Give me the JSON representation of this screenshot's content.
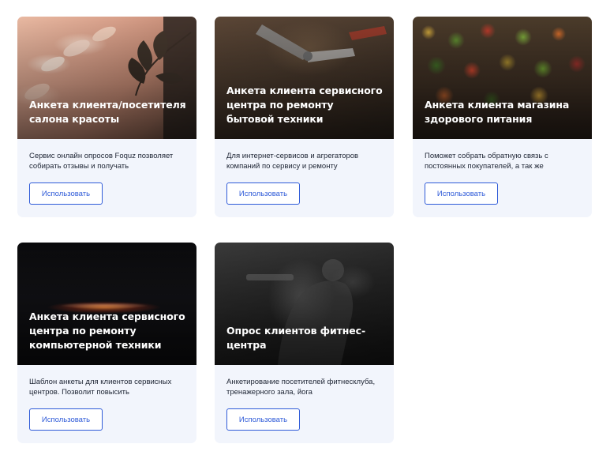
{
  "cards": [
    {
      "image": "beauty-salon-photo",
      "title": "Анкета клиента/посетителя салона красоты",
      "description": "Сервис онлайн опросов Foquz позволяет собирать отзывы и получать",
      "button_label": "Использовать"
    },
    {
      "image": "repair-tools-photo",
      "title": "Анкета клиента сервисного центра по ремонту бытовой техники",
      "description": "Для интернет-сервисов и агрегаторов компаний по сервису и ремонту",
      "button_label": "Использовать"
    },
    {
      "image": "vegetable-market-photo",
      "title": "Анкета клиента магазина здорового питания",
      "description": "Поможет собрать обратную связь с постоянных покупателей, а так же",
      "button_label": "Использовать"
    },
    {
      "image": "laptop-glow-photo",
      "title": "Анкета клиента сервисного центра по ремонту компьютерной техники",
      "description": "Шаблон анкеты для клиентов сервисных центров. Позволит повысить",
      "button_label": "Использовать"
    },
    {
      "image": "fitness-gym-photo",
      "title": "Опрос клиентов фитнес-центра",
      "description": "Анкетирование посетителей фитнесклуба, тренажерного зала, йога",
      "button_label": "Использовать"
    }
  ]
}
